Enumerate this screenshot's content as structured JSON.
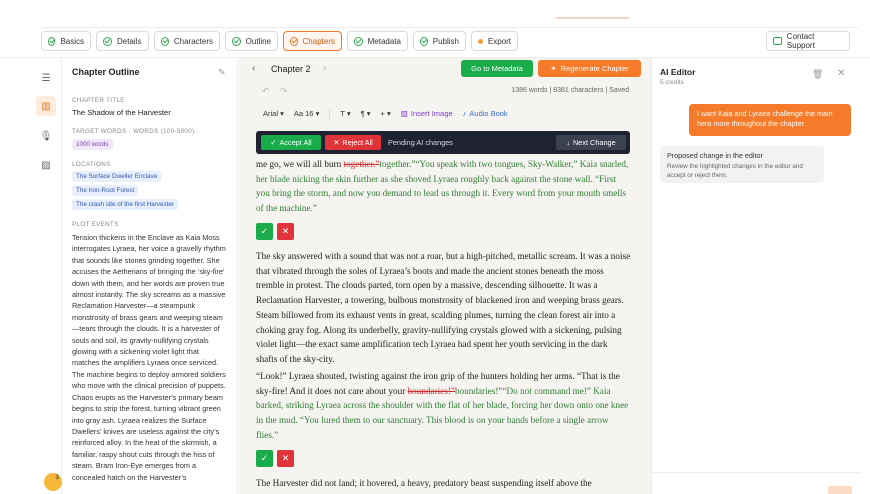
{
  "tabs": [
    {
      "label": "Basics"
    },
    {
      "label": "Details"
    },
    {
      "label": "Characters"
    },
    {
      "label": "Outline"
    },
    {
      "label": "Chapters"
    },
    {
      "label": "Metadata"
    },
    {
      "label": "Publish"
    },
    {
      "label": "Export"
    }
  ],
  "support_label": "Contact Support",
  "outline": {
    "title": "Chapter Outline",
    "chapter_title_label": "CHAPTER TITLE",
    "chapter_title": "The Shadow of the Harvester",
    "target_words_label": "TARGET WORDS · WORDS (100-5000)",
    "target_words": "1000 words",
    "locations_label": "LOCATIONS",
    "locations": [
      "The Surface Dweller Enclave",
      "The Iron-Root Forest",
      "The crash site of the first Harvester"
    ],
    "plot_label": "PLOT EVENTS",
    "plot_text": "Tension thickens in the Enclave as Kaia Moss interrogates Lyraea, her voice a gravelly rhythm that sounds like stones grinding together. She accuses the Aetherians of bringing the ‘sky-fire’ down with them, and her words are proven true almost instantly. The sky screams as a massive Reclamation Harvester—a steampunk monstrosity of brass gears and weeping steam—tears through the clouds. It is a harvester of souls and soil, its gravity-nullifying crystals glowing with a sickening violet light that matches the amplifiers Lyraea once serviced. The machine begins to deploy armored soldiers who move with the clinical precision of puppets. Chaos erupts as the Harvester’s primary beam begins to strip the forest, turning vibrant green into gray ash. Lyraea realizes the Surface Dwellers’ knives are useless against the city’s reinforced alloy. In the heat of the skirmish, a familiar, raspy shout cuts through the hiss of steam. Bram Iron-Eye emerges from a concealed hatch on the Harvester’s"
  },
  "avatar_count": "3",
  "editor": {
    "chapter_label": "Chapter 2",
    "metadata_button": "Go to Metadata",
    "regenerate_button": "Regenerate Chapter",
    "stats": "1386 words | 8381 characters | Saved",
    "font": "Arial",
    "size": "Aa 16",
    "insert_image": "Insert Image",
    "audio_book": "Audio Book",
    "accept_all": "Accept All",
    "reject_all": "Reject All",
    "pending_label": "Pending AI changes",
    "next_change": "Next Change",
    "p1_a": "me go, we will all burn ",
    "p1_del": "together.”",
    "p1_ins": "together.”“You speak with two tongues, Sky-Walker,” Kaia snarled, her blade nicking the skin further as she shoved Lyraea roughly back against the stone wall. “First you bring the storm, and now you demand to lead us through it. Every word from your mouth smells of the machine.”",
    "p2": "The sky answered with a sound that was not a roar, but a high-pitched, metallic scream. It was a noise that vibrated through the soles of Lyraea’s boots and made the ancient stones beneath the moss tremble in protest. The clouds parted, torn open by a massive, descending silhouette. It was a Reclamation Harvester, a towering, bulbous monstrosity of blackened iron and weeping brass gears. Steam billowed from its exhaust vents in great, scalding plumes, turning the clean forest air into a choking gray fog. Along its underbelly, gravity-nullifying crystals glowed with a sickening, pulsing violet light—the exact same amplification tech Lyraea had spent her youth servicing in the dark shafts of the sky-city.",
    "p3_a": "“Look!” Lyraea shouted, twisting against the iron grip of the hunters holding her arms. “That is the sky-fire! And it does not care about your ",
    "p3_del": "boundaries!”",
    "p3_ins": "boundaries!”“Do not command me!” Kaia barked, striking Lyraea across the shoulder with the flat of her blade, forcing her down onto one knee in the mud. “You lured them to our sanctuary. This blood is on your hands before a single arrow flies.”",
    "p4": "The Harvester did not land; it hovered, a heavy, predatory beast suspending itself above the"
  },
  "ai": {
    "title": "AI Editor",
    "credits": "5 credits",
    "user_message": "I want Kaia and Lyraea challenge the main hero more throughout the chapter",
    "reply_title": "Proposed change in the editor",
    "reply_body": "Review the highlighted changes in the editor and accept or reject them."
  }
}
